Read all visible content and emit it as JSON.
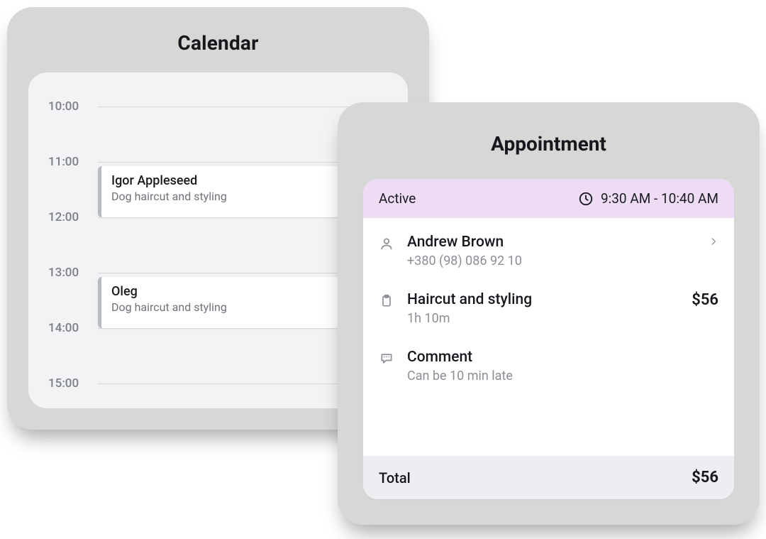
{
  "calendar": {
    "title": "Calendar",
    "times": [
      "10:00",
      "11:00",
      "12:00",
      "13:00",
      "14:00",
      "15:00"
    ],
    "events": [
      {
        "name": "Igor Appleseed",
        "service": "Dog haircut and styling"
      },
      {
        "name": "Oleg",
        "service": "Dog haircut and styling"
      }
    ]
  },
  "appointment": {
    "title": "Appointment",
    "status": "Active",
    "time_range": "9:30 AM - 10:40 AM",
    "client": {
      "name": "Andrew Brown",
      "phone": "+380 (98) 086 92 10"
    },
    "service": {
      "name": "Haircut and styling",
      "duration": "1h 10m",
      "price": "$56"
    },
    "comment": {
      "label": "Comment",
      "text": "Can be 10 min late"
    },
    "total_label": "Total",
    "total": "$56"
  }
}
